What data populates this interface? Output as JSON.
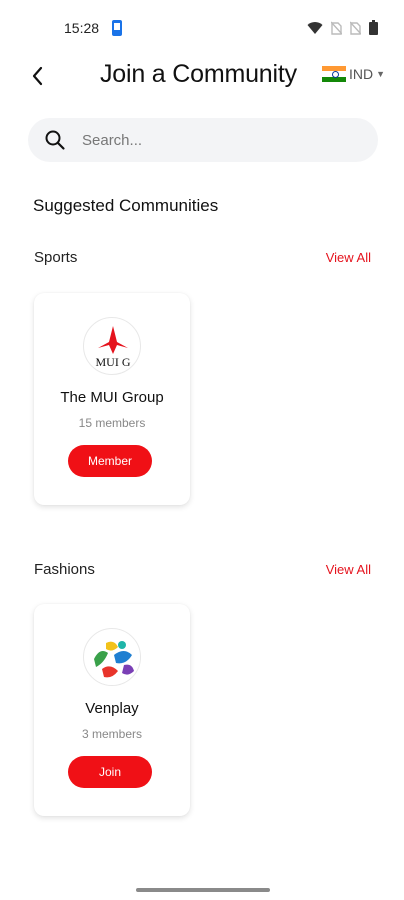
{
  "status_bar": {
    "time": "15:28"
  },
  "header": {
    "title": "Join a Community",
    "country": {
      "code": "IND"
    }
  },
  "search": {
    "placeholder": "Search..."
  },
  "section": {
    "title": "Suggested Communities"
  },
  "categories": [
    {
      "name": "Sports",
      "view_all": "View All",
      "card": {
        "name": "The MUI Group",
        "members": "15 members",
        "action": "Member",
        "logo_text": "MUI G"
      }
    },
    {
      "name": "Fashions",
      "view_all": "View All",
      "card": {
        "name": "Venplay",
        "members": "3 members",
        "action": "Join"
      }
    }
  ],
  "colors": {
    "accent": "#f01016",
    "link": "#e5131d"
  }
}
